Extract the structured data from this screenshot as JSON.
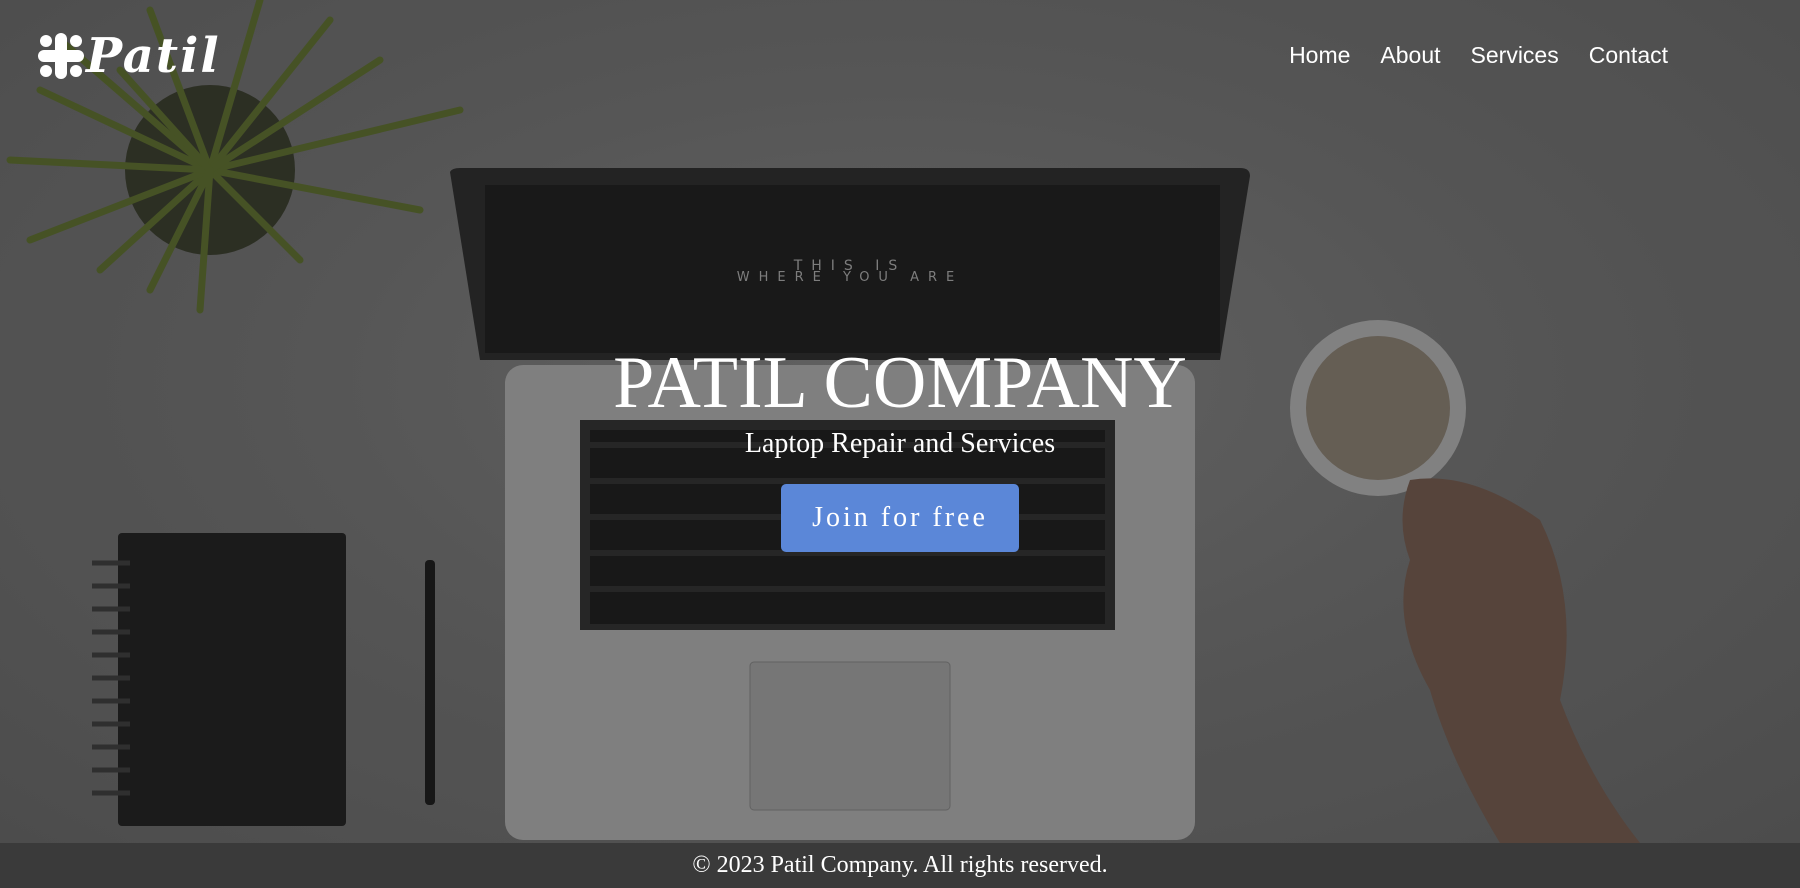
{
  "brand": {
    "name": "Patil",
    "icon": "slack-like-logo-icon"
  },
  "nav": {
    "items": [
      {
        "label": "Home"
      },
      {
        "label": "About"
      },
      {
        "label": "Services"
      },
      {
        "label": "Contact"
      }
    ]
  },
  "hero": {
    "title": "PATIL COMPANY",
    "subtitle": "Laptop Repair and Services",
    "cta_label": "Join for free",
    "screen_text_1": "THIS IS",
    "screen_text_2": "WHERE YOU ARE"
  },
  "footer": {
    "text": "© 2023 Patil Company. All rights reserved."
  },
  "colors": {
    "cta": "#5b87d8",
    "footer_bg": "#3a3a3a",
    "overlay": "#5a5a5a"
  }
}
